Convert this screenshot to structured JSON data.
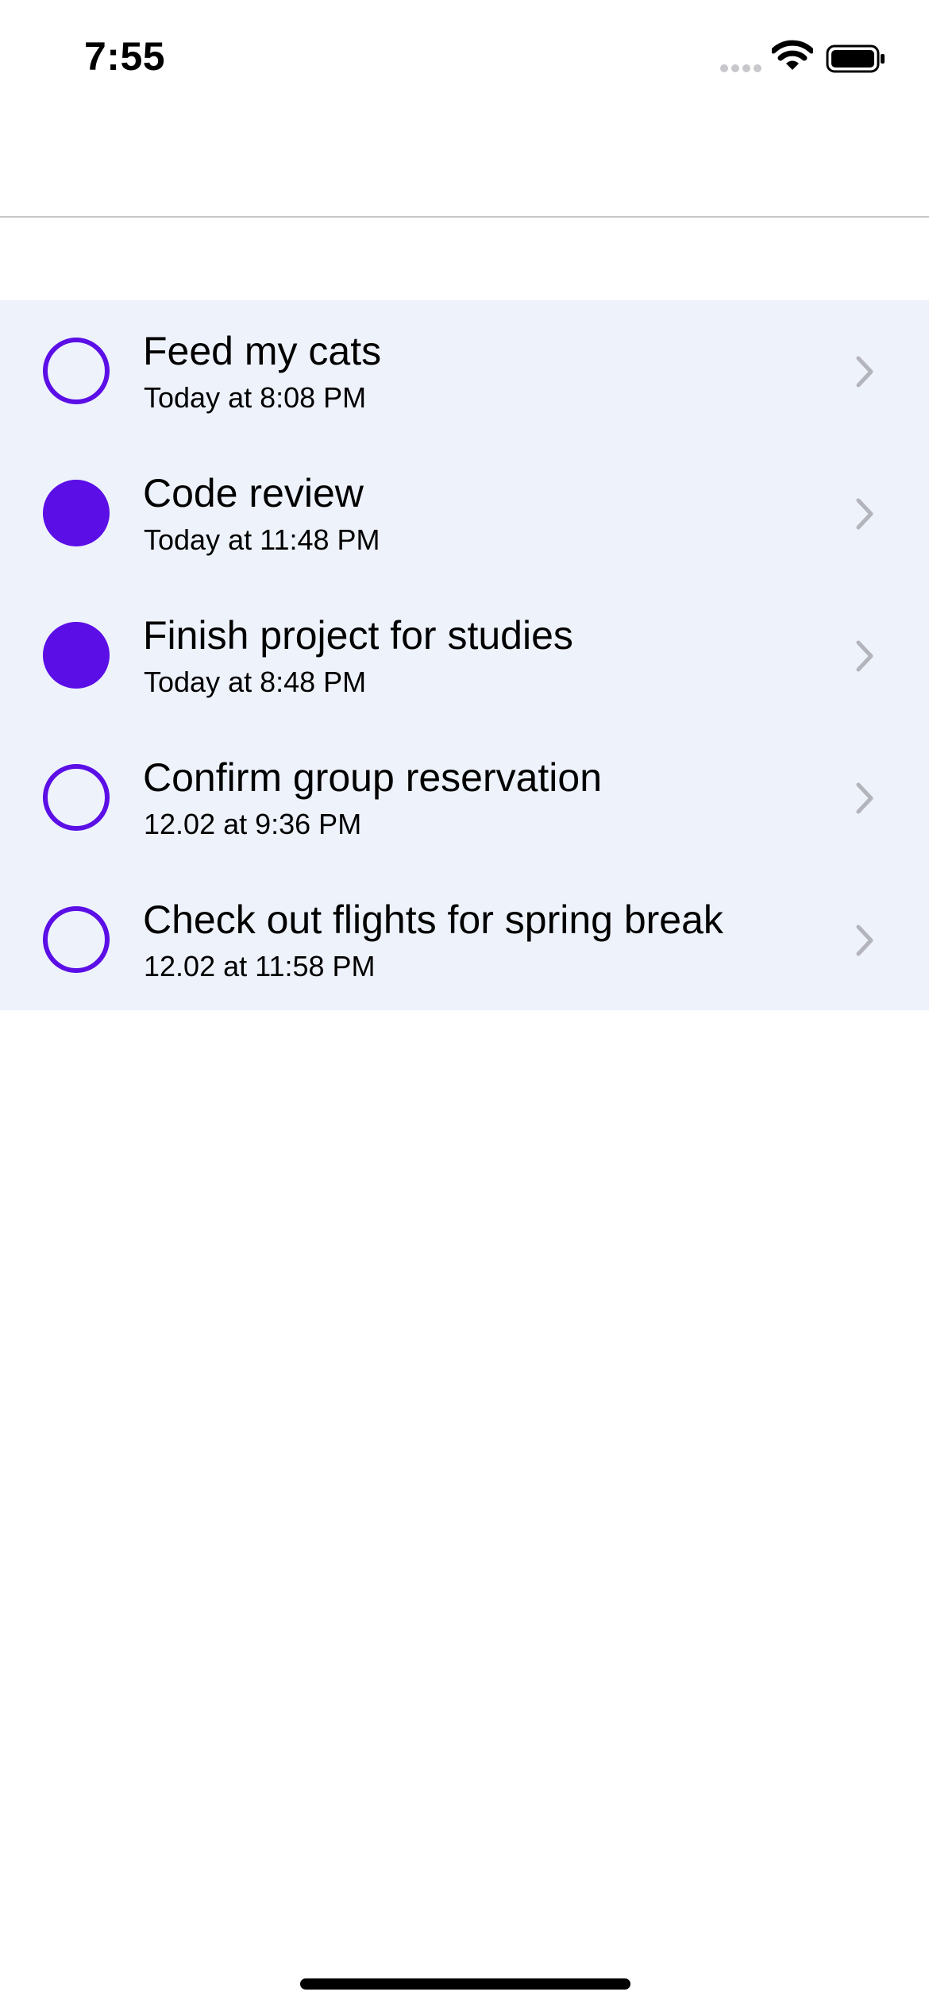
{
  "status_bar": {
    "time": "7:55",
    "icons": [
      "signal-icon",
      "wifi-icon",
      "battery-icon"
    ]
  },
  "theme": {
    "accent": "#5b0ee6",
    "list_background": "#eef2fb",
    "chevron": "#b4b4bc"
  },
  "tasks": [
    {
      "title": "Feed my cats",
      "time": "Today at 8:08 PM",
      "completed": false
    },
    {
      "title": "Code review",
      "time": "Today at 11:48 PM",
      "completed": true
    },
    {
      "title": "Finish project for studies",
      "time": "Today at 8:48 PM",
      "completed": true
    },
    {
      "title": "Confirm group reservation",
      "time": "12.02 at 9:36 PM",
      "completed": false
    },
    {
      "title": "Check out flights for spring break",
      "time": "12.02 at 11:58 PM",
      "completed": false
    }
  ]
}
